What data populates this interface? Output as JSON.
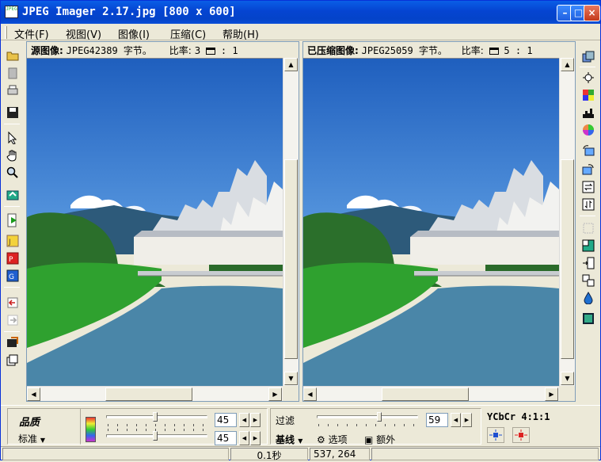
{
  "window": {
    "title": "JPEG Imager 2.17.jpg [800 x 600]",
    "app_icon_text": "JPEG"
  },
  "menu": [
    {
      "label": "文件(F)"
    },
    {
      "label": "视图(V)"
    },
    {
      "label": "图像(I)"
    },
    {
      "label": "压缩(C)"
    },
    {
      "label": "帮助(H)"
    }
  ],
  "source_pane": {
    "label": "源图像:",
    "value": "JPEG42389 字节。",
    "ratio_label": "比率:",
    "ratio_pre": "3",
    "ratio_suffix": ": 1"
  },
  "compressed_pane": {
    "label": "已压缩图像:",
    "value": "JPEG25059 字节。",
    "ratio_label": "比率:",
    "ratio_value": "5 : 1"
  },
  "quality": {
    "label": "品质",
    "mode": "标准",
    "slider1_value": "45",
    "slider2_value": "45"
  },
  "filter": {
    "label": "过滤",
    "value": "59",
    "baseline_label": "基线",
    "options_label": "选项",
    "extra_label": "额外"
  },
  "ycbcr": {
    "label": "YCbCr 4:1:1"
  },
  "status": {
    "time": "0.1秒",
    "coords": "537, 264"
  },
  "colors": {
    "titlebar": "#0A5EE6",
    "sky": "#1F5FBE",
    "grass": "#2FA12F",
    "water": "#4A86A8"
  }
}
